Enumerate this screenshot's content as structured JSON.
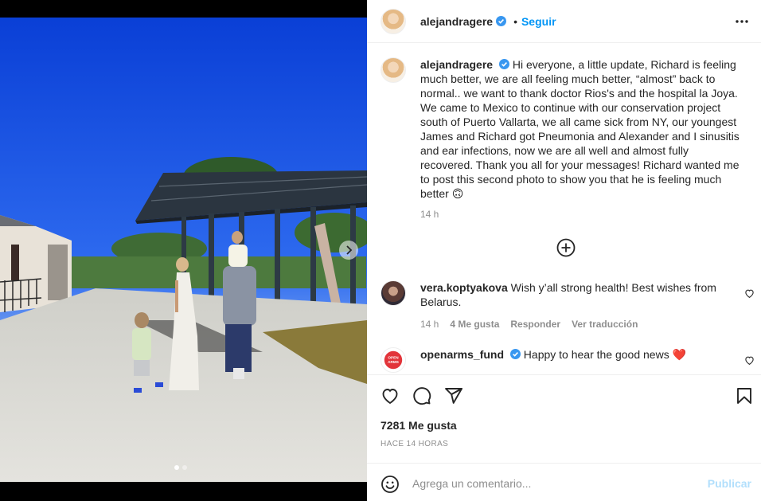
{
  "header": {
    "username": "alejandragere",
    "separator": "•",
    "follow_label": "Seguir"
  },
  "caption": {
    "username": "alejandragere",
    "text": "Hi everyone, a little update, Richard is feeling much better, we are all feeling much better, “almost” back to normal.. we want to thank doctor Rios's and the hospital la Joya. We came to Mexico to continue with our conservation project south of Puerto Vallarta, we all came sick from NY, our youngest James and Richard got Pneumonia and Alexander and I sinusitis and ear infections, now we are all well and almost fully recovered. Thank you all for your messages! Richard wanted me to post this second photo to show you that he is feeling much better 🙃",
    "time": "14 h"
  },
  "comments": [
    {
      "username": "vera.koptyakova",
      "text": "Wish y’all strong health! Best wishes from Belarus.",
      "time": "14 h",
      "likes": "4 Me gusta",
      "reply_label": "Responder",
      "translate_label": "Ver traducción"
    },
    {
      "username": "openarms_fund",
      "text": "Happy to hear the good news ❤️"
    }
  ],
  "openarms_logo_text": "OPEN ARMS",
  "likes_count": "7281 Me gusta",
  "timestamp": "HACE 14 HORAS",
  "add_comment": {
    "placeholder": "Agrega un comentario...",
    "publish_label": "Publicar"
  },
  "icons": [
    "verified-badge-icon",
    "more-options-icon",
    "plus-circle-icon",
    "heart-icon",
    "comment-icon",
    "share-icon",
    "bookmark-icon",
    "emoji-icon",
    "chevron-right-icon"
  ],
  "colors": {
    "accent": "#0095f6",
    "publish_disabled": "#b2dffc",
    "heart_red": "#ed4956",
    "secondary_text": "#8e8e8e"
  },
  "carousel": {
    "slides": 2,
    "active_slide": 1
  }
}
